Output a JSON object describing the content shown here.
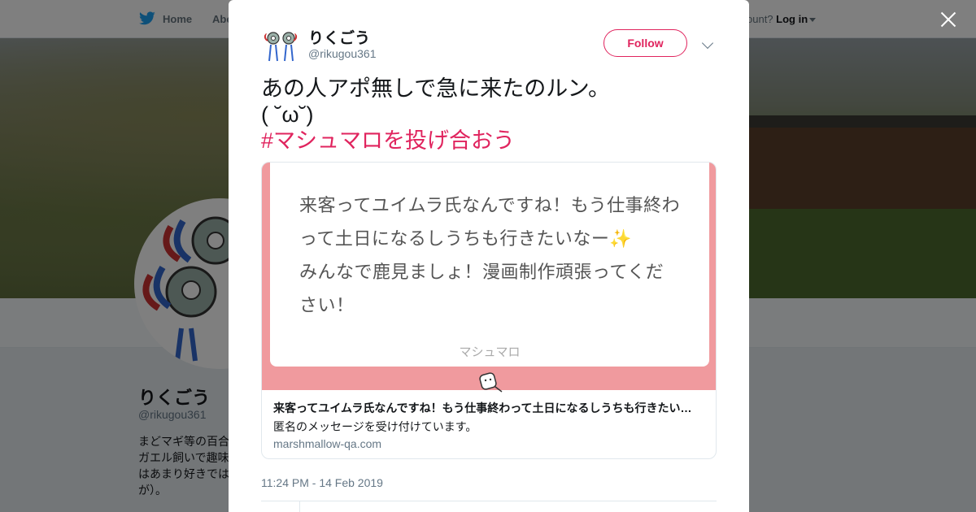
{
  "nav": {
    "home_label": "Home",
    "about_label": "Abo",
    "account_prompt": "ccount?",
    "login_label": "Log in"
  },
  "profile": {
    "name": "りくごう",
    "handle": "@rikugou361",
    "bio": "まどマギ等の百合\nガエル飼いで趣味\nはあまり好きでは\nが）。"
  },
  "tweet": {
    "author_name": "りくごう",
    "author_handle": "@rikugou361",
    "follow_label": "Follow",
    "text_line1": "あの人アポ無しで急に来たのルン。",
    "text_line2": "( ˘ω˘)",
    "hashtag": "#マシュマロを投げ合おう",
    "timestamp": "11:24 PM - 14 Feb 2019"
  },
  "card": {
    "quote_part1": "来客ってユイムラ氏なんですね！もう仕事終わって土日になるしうちも行きたいなー",
    "quote_sparkle": "✨",
    "quote_part2": "みんなで鹿見ましょ！漫画制作頑張ってください！",
    "brand": "マシュマロ",
    "title": "来客ってユイムラ氏なんですね！もう仕事終わって土日になるしうちも行きたい…",
    "description": "匿名のメッセージを受け付けています。",
    "domain": "marshmallow-qa.com"
  },
  "colors": {
    "accent": "#e0245e",
    "card_pink": "#f09a9e",
    "twitter_blue": "#1da1f2"
  }
}
